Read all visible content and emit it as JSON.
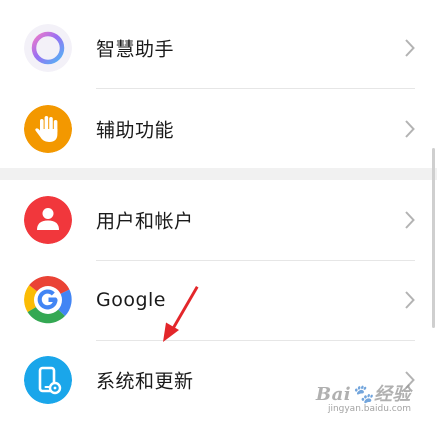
{
  "settings": {
    "items": [
      {
        "label": "智慧助手",
        "icon": "smart-assistant-icon"
      },
      {
        "label": "辅助功能",
        "icon": "accessibility-hand-icon"
      },
      {
        "label": "用户和帐户",
        "icon": "user-account-icon"
      },
      {
        "label": "Google",
        "icon": "google-icon"
      },
      {
        "label": "系统和更新",
        "icon": "system-phone-gear-icon"
      }
    ]
  },
  "colors": {
    "accessibility": "#F39800",
    "users": "#F1373C",
    "system": "#1AA6EA",
    "arrow": "#E3262A",
    "group_gap": "#F1F1F1"
  },
  "watermark": {
    "brand_a": "Bai",
    "brand_paw": "🐾",
    "brand_b": "经验",
    "url": "jingyan.baidu.com"
  }
}
